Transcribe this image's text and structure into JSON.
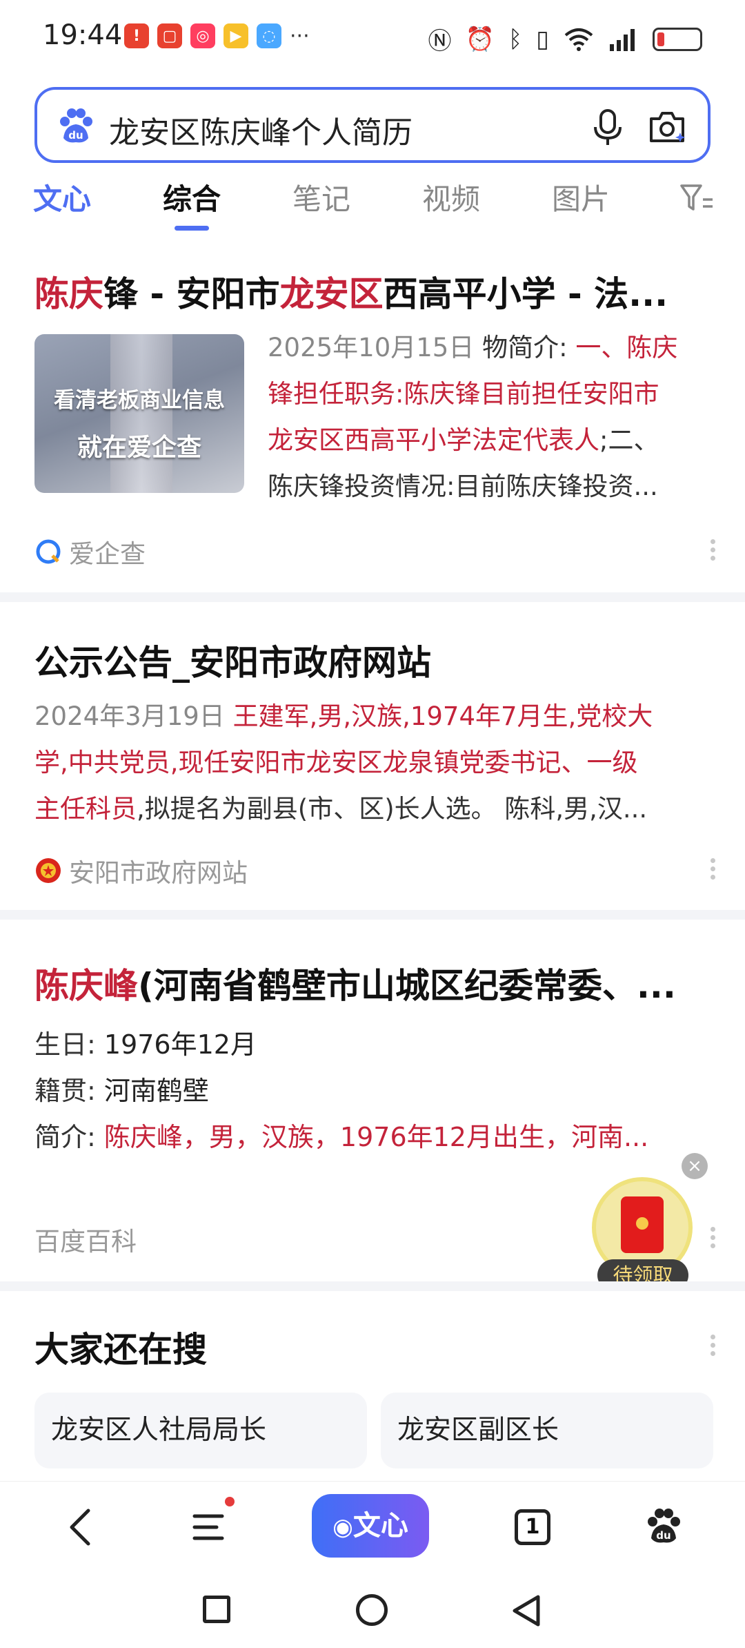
{
  "status_bar": {
    "time": "19:44",
    "more": "···"
  },
  "search": {
    "query": "龙安区陈庆峰个人简历"
  },
  "tabs": [
    {
      "label": "文心"
    },
    {
      "label": "综合"
    },
    {
      "label": "笔记"
    },
    {
      "label": "视频"
    },
    {
      "label": "图片"
    }
  ],
  "results": [
    {
      "title_parts": [
        "陈庆",
        "锋 - 安阳市",
        "龙安区",
        "西高平小学 - 法..."
      ],
      "thumb_line1": "看清老板商业信息",
      "thumb_line2": "就在爱企查",
      "date": "2025年10月15日",
      "snippet_plain": "物简介:",
      "snippet_line1_hl": "一、陈庆",
      "snippet_line2_hl": "锋担任职务:陈庆锋目前担任安阳市",
      "snippet_line3_hl": "龙安区西高平小学法定代表人",
      "snippet_line3_plain": ";二、",
      "snippet_line4_plain": "陈庆锋投资情况:目前陈庆锋投资...",
      "source": "爱企查"
    },
    {
      "title": "公示公告_安阳市政府网站",
      "date": "2024年3月19日",
      "snippet_line1_hl": "王建军,男,汉族,1974年7月生,党校大",
      "snippet_line2_hl": "学,中共党员,现任安阳市龙安区龙泉镇党委书记、一级",
      "snippet_line3_hl": "主任科员",
      "snippet_line3_plain": ",拟提名为副县(市、区)长人选。 陈科,男,汉...",
      "source": "安阳市政府网站"
    },
    {
      "title_hl": "陈庆峰",
      "title_plain": "(河南省鹤壁市山城区纪委常委、...",
      "birthday_label": "生日:",
      "birthday_value": "1976年12月",
      "origin_label": "籍贯:",
      "origin_value": "河南鹤壁",
      "intro_label": "简介:",
      "intro_value": "陈庆峰，男，汉族，1976年12月出生，河南...",
      "source": "百度百科"
    }
  ],
  "redpacket": {
    "label": "待领取",
    "close": "×"
  },
  "also_search": {
    "title": "大家还在搜",
    "items": [
      "龙安区人社局局长",
      "龙安区副区长"
    ]
  },
  "bottom_nav": {
    "wenxin_label": "文心",
    "tab_count": "1"
  },
  "colors": {
    "accent": "#4e6ef2",
    "highlight": "#c4233a"
  }
}
